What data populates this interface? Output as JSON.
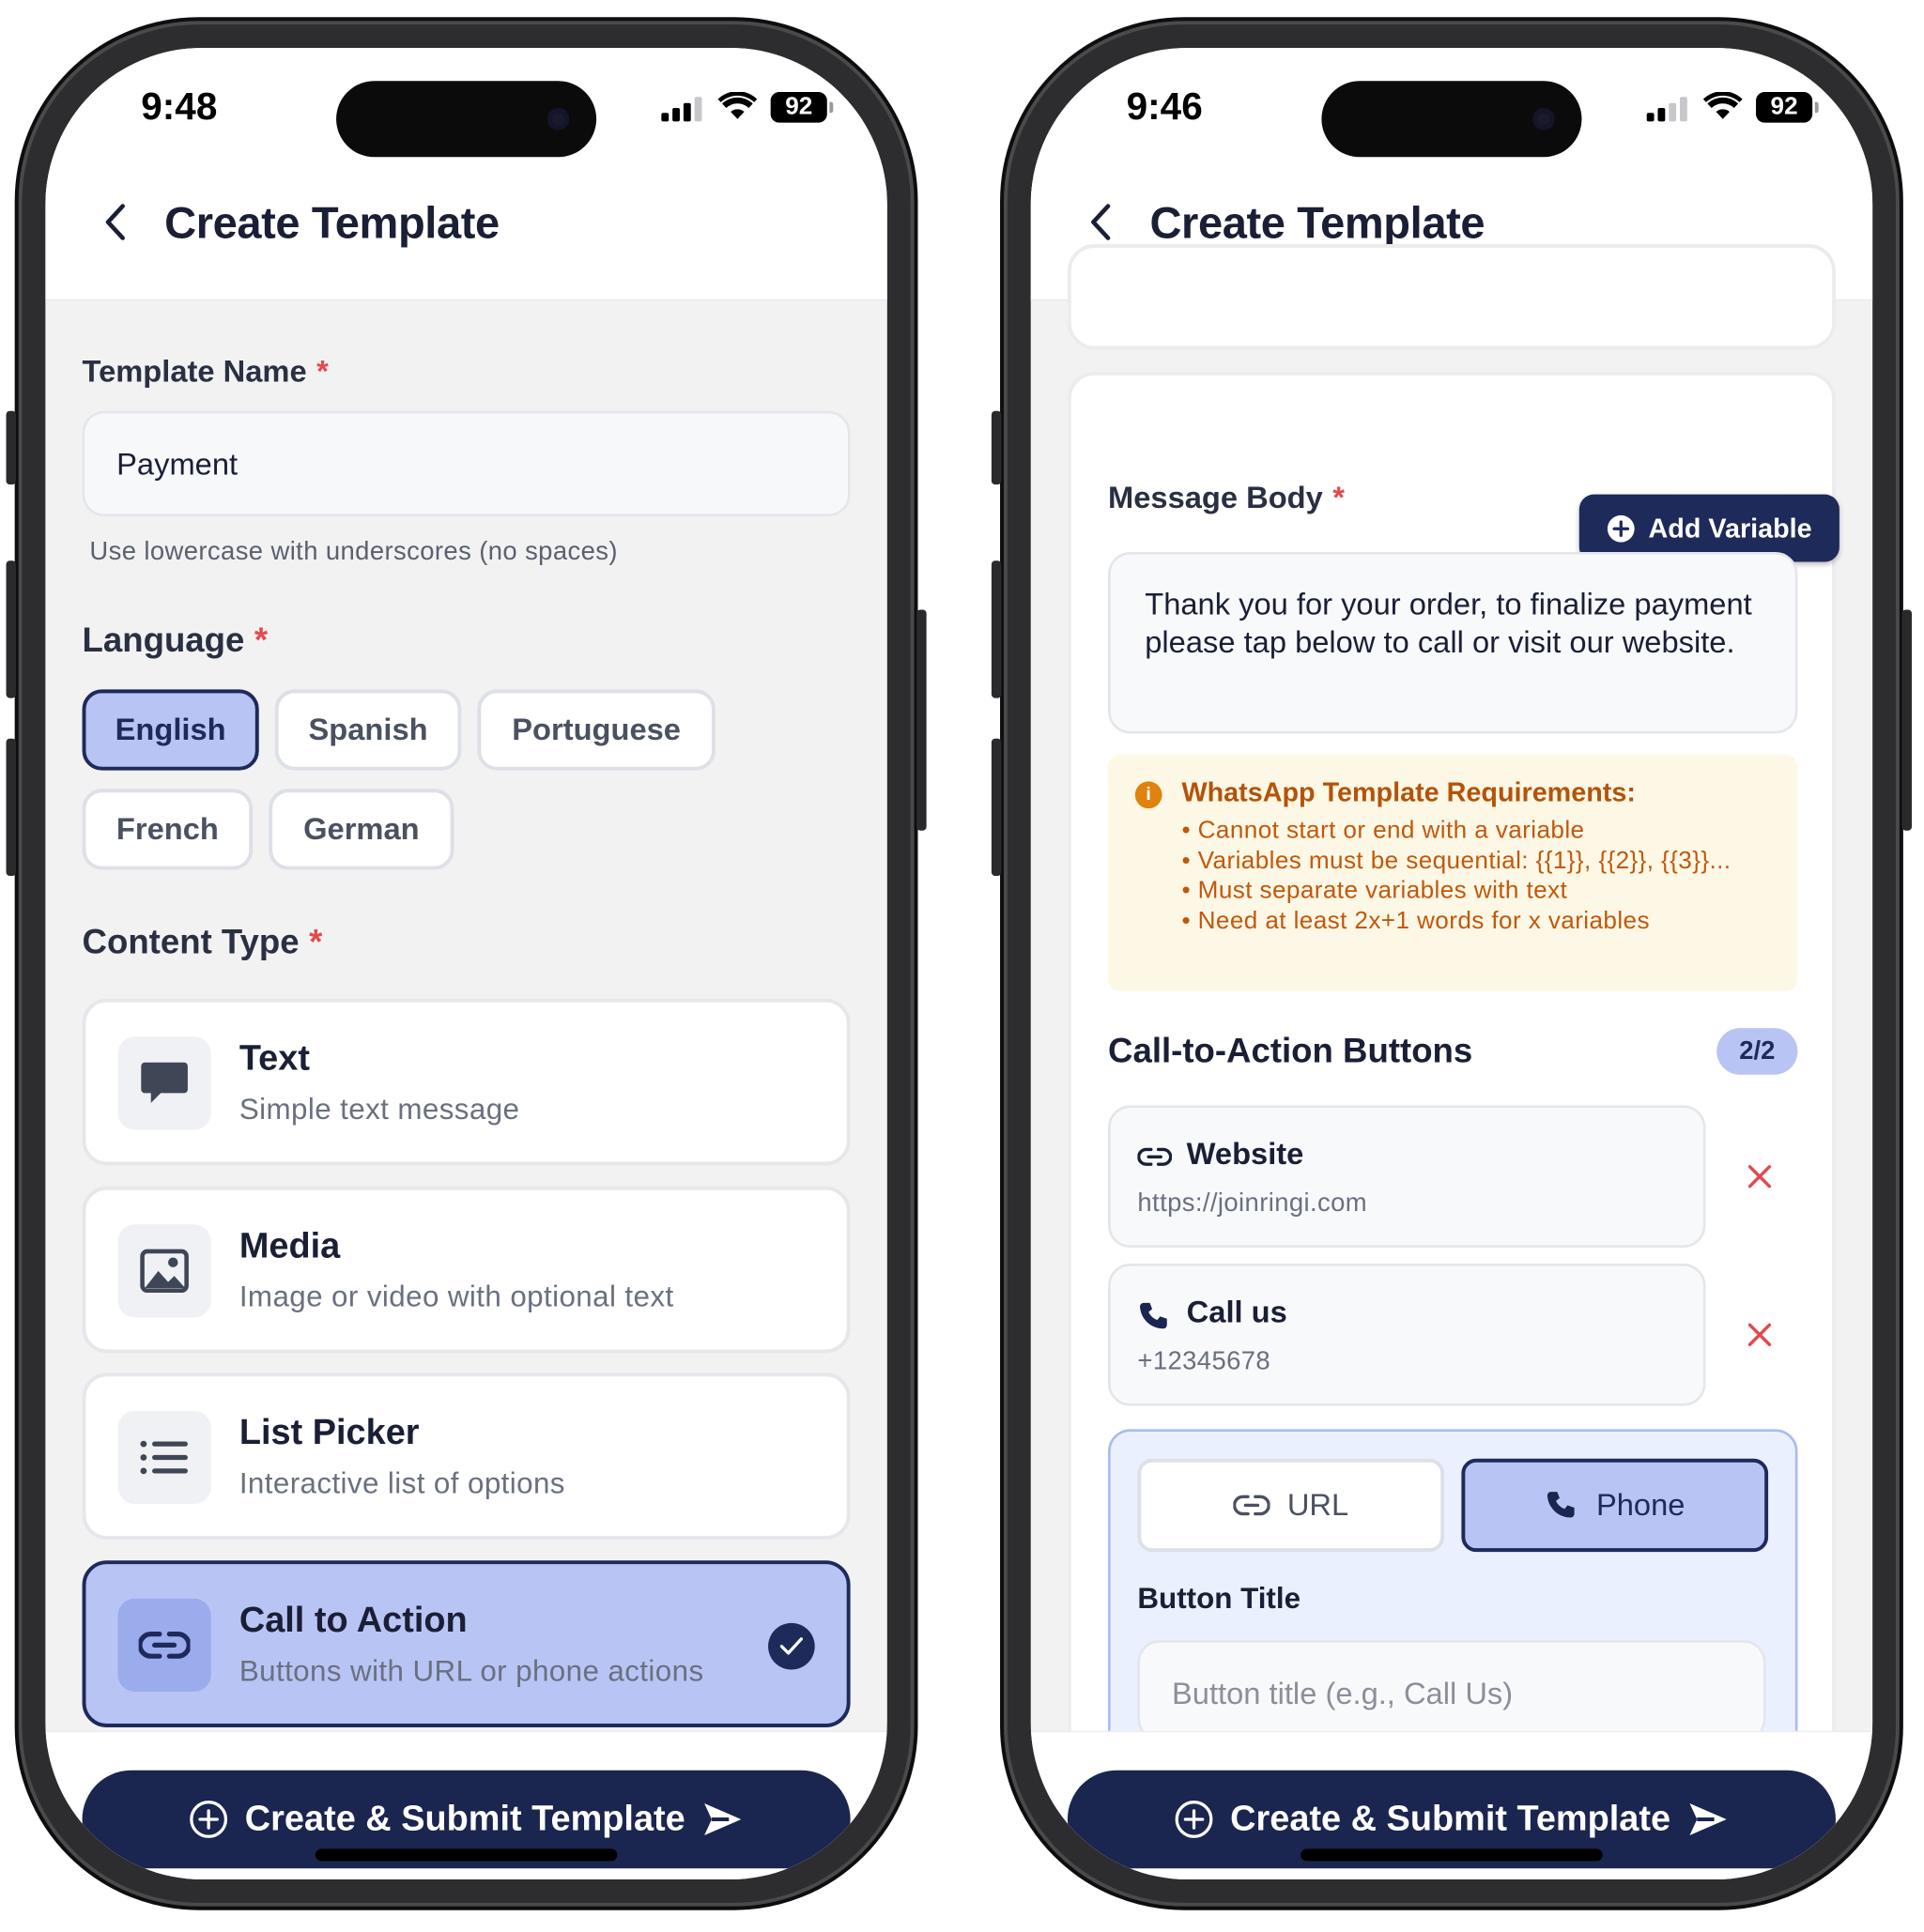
{
  "left": {
    "status": {
      "time": "9:48",
      "battery": "92"
    },
    "header": {
      "title": "Create Template"
    },
    "template_name": {
      "label": "Template Name",
      "required": "*",
      "value": "Payment",
      "hint": "Use lowercase with underscores (no spaces)"
    },
    "language": {
      "label": "Language",
      "required": "*",
      "options": [
        "English",
        "Spanish",
        "Portuguese",
        "French",
        "German"
      ],
      "selected": "English"
    },
    "content_type": {
      "label": "Content Type",
      "required": "*",
      "items": [
        {
          "title": "Text",
          "subtitle": "Simple text message",
          "icon": "chat-bubble-icon"
        },
        {
          "title": "Media",
          "subtitle": "Image or video with optional text",
          "icon": "image-icon"
        },
        {
          "title": "List Picker",
          "subtitle": "Interactive list of options",
          "icon": "list-icon"
        },
        {
          "title": "Call to Action",
          "subtitle": "Buttons with URL or phone actions",
          "icon": "link-icon"
        }
      ],
      "selected": "Call to Action"
    },
    "footer": {
      "submit_label": "Create & Submit Template"
    }
  },
  "right": {
    "status": {
      "time": "9:46",
      "battery": "92"
    },
    "header": {
      "title": "Create Template"
    },
    "add_variable_label": "Add Variable",
    "message_body": {
      "label": "Message Body",
      "required": "*",
      "value": "Thank you for your order, to finalize payment please tap below to call or visit our website."
    },
    "requirements": {
      "title": "WhatsApp Template Requirements:",
      "items": [
        "Cannot start or end with a variable",
        "Variables must be sequential: {{1}}, {{2}}, {{3}}...",
        "Must separate variables with text",
        "Need at least 2x+1 words for x variables"
      ]
    },
    "cta": {
      "title": "Call-to-Action Buttons",
      "count": "2/2",
      "buttons": [
        {
          "title": "Website",
          "value": "https://joinringi.com",
          "icon": "link-icon"
        },
        {
          "title": "Call us",
          "value": "+12345678",
          "icon": "phone-icon"
        }
      ]
    },
    "editor": {
      "types": [
        "URL",
        "Phone"
      ],
      "selected": "Phone",
      "button_title_label": "Button Title",
      "button_title_placeholder": "Button title (e.g., Call Us)"
    },
    "footer": {
      "submit_label": "Create & Submit Template"
    }
  },
  "colors": {
    "primary": "#1a2550",
    "selected_bg": "#b8c5f4",
    "required": "#e5484d",
    "warning_bg": "#fdf8e6",
    "warning_text": "#c2580c",
    "delete": "#e5484d"
  }
}
